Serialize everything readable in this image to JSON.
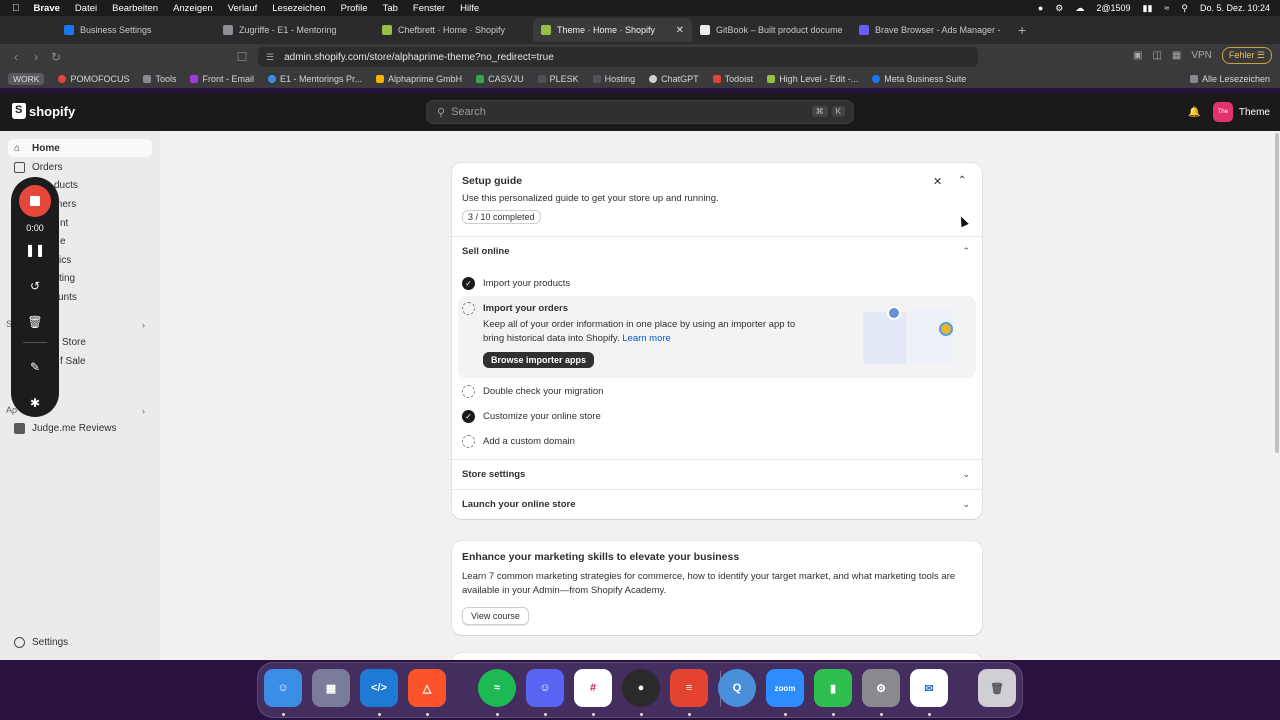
{
  "menubar": {
    "app": "Brave",
    "items": [
      "Datei",
      "Bearbeiten",
      "Anzeigen",
      "Verlauf",
      "Lesezeichen",
      "Profile",
      "Tab",
      "Fenster",
      "Hilfe"
    ],
    "status": "2@1509",
    "datetime": "Do. 5. Dez.  10:24"
  },
  "tabs": [
    {
      "label": "Business Settings",
      "color": "#1877f2"
    },
    {
      "label": "Zugriffe - E1 - Mentoring",
      "color": "#8e8e93"
    },
    {
      "label": "Chefbrett · Home · Shopify",
      "color": "#95bf47"
    },
    {
      "label": "Theme · Home · Shopify",
      "color": "#95bf47",
      "active": true
    },
    {
      "label": "GitBook – Built product documen",
      "color": "#eeeeee"
    },
    {
      "label": "Brave Browser - Ads Manager - M",
      "color": "#6b5cff"
    }
  ],
  "address": {
    "url": "admin.shopify.com/store/alphaprime-theme?no_redirect=true",
    "vpn": "VPN",
    "error_label": "Fehler"
  },
  "bookmarks": {
    "work": "WORK",
    "items": [
      "POMOFOCUS",
      "Tools",
      "Front - Email",
      "E1 - Mentorings Pr...",
      "Alphaprime GmbH",
      "CASVJU",
      "PLESK",
      "Hosting",
      "ChatGPT",
      "Todoist",
      "High Level - Edit -...",
      "Meta Business Suite"
    ],
    "all": "Alle Lesezeichen"
  },
  "admin": {
    "logo": "shopify",
    "search_placeholder": "Search",
    "kbd1": "⌘",
    "kbd2": "K",
    "store_short": "The",
    "store_name": "Theme"
  },
  "sidebar": {
    "home": "Home",
    "orders": "Orders",
    "products": "ducts",
    "customers": "mers",
    "content": "nt",
    "finance": "e",
    "analytics": "ics",
    "marketing": "ting",
    "discounts": "unts",
    "sales_section": "S",
    "online_store": "Store",
    "pos": "f Sale",
    "apps_section": "Ap",
    "judgeme": "Judge.me Reviews",
    "settings": "Settings"
  },
  "recorder": {
    "time": "0:00"
  },
  "setup": {
    "title": "Setup guide",
    "subtitle": "Use this personalized guide to get your store up and running.",
    "progress": "3 / 10 completed",
    "sell_online": "Sell online",
    "tasks": {
      "import_products": "Import your products",
      "import_orders": "Import your orders",
      "import_orders_desc1": "Keep all of your order information in one place by using an importer app to",
      "import_orders_desc2": "bring historical data into Shopify.",
      "learn_more": "Learn more",
      "browse": "Browse importer apps",
      "migration": "Double check your migration",
      "customize": "Customize your online store",
      "domain": "Add a custom domain"
    },
    "store_settings": "Store settings",
    "launch": "Launch your online store"
  },
  "marketing": {
    "title": "Enhance your marketing skills to elevate your business",
    "desc1": "Learn 7 common marketing strategies for commerce, how to identify your target market, and what marketing tools are",
    "desc2": "available in your Admin—from Shopify Academy.",
    "button": "View course"
  },
  "dock": [
    {
      "name": "Finder",
      "color": "#3a8ee6"
    },
    {
      "name": "Launchpad",
      "color": "#7b7b9a"
    },
    {
      "name": "VS Code",
      "color": "#1f7ad6"
    },
    {
      "name": "Brave",
      "color": "#fb542b"
    },
    {
      "name": "Spotify",
      "color": "#1db954"
    },
    {
      "name": "Discord",
      "color": "#5865f2"
    },
    {
      "name": "Slack",
      "color": "#ffffff"
    },
    {
      "name": "Screen Recorder",
      "color": "#2a2a2a"
    },
    {
      "name": "Todoist",
      "color": "#e44332"
    },
    {
      "name": "QuickTime",
      "color": "#4a90d9"
    },
    {
      "name": "Zoom",
      "color": "#2d8cff"
    },
    {
      "name": "Numbers",
      "color": "#2fbf4e"
    },
    {
      "name": "System Settings",
      "color": "#8a8a8e"
    },
    {
      "name": "Mail",
      "color": "#ffffff"
    },
    {
      "name": "Trash",
      "color": "#cfcfd4"
    }
  ]
}
